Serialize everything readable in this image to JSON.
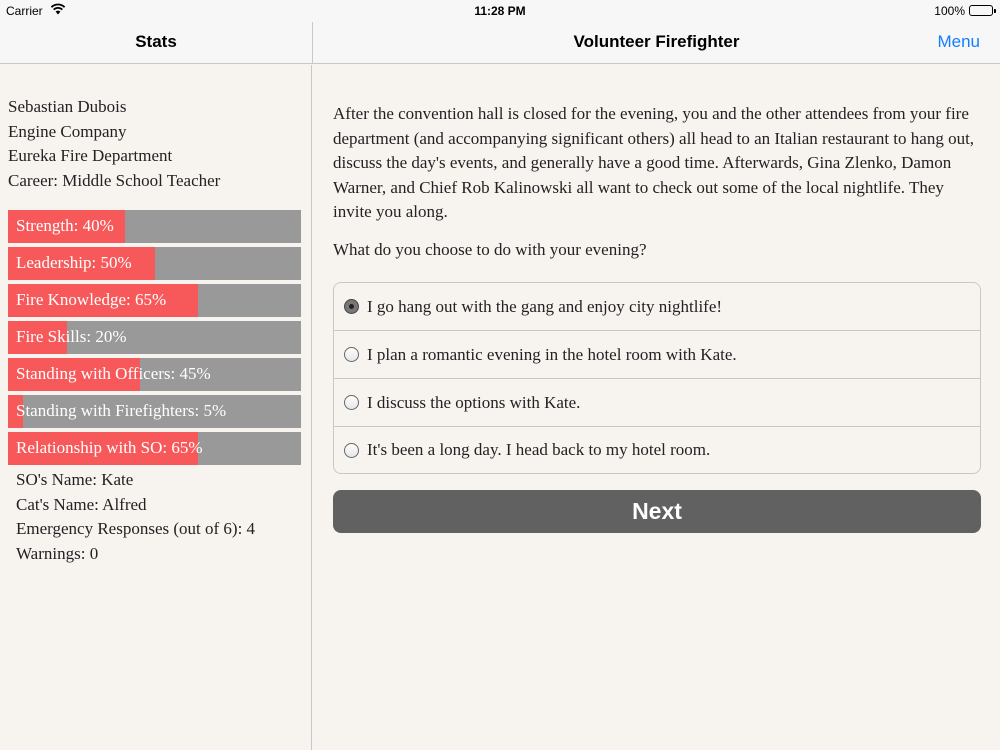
{
  "status_bar": {
    "carrier": "Carrier",
    "time": "11:28 PM",
    "battery": "100%"
  },
  "nav": {
    "left_title": "Stats",
    "title": "Volunteer Firefighter",
    "menu_label": "Menu"
  },
  "sidebar": {
    "info": [
      "Sebastian Dubois",
      "Engine Company",
      "Eureka Fire Department",
      "Career: Middle School Teacher"
    ],
    "stats": [
      {
        "label": "Strength: 40%",
        "value": 40
      },
      {
        "label": "Leadership: 50%",
        "value": 50
      },
      {
        "label": "Fire Knowledge: 65%",
        "value": 65
      },
      {
        "label": "Fire Skills: 20%",
        "value": 20
      },
      {
        "label": "Standing with Officers: 45%",
        "value": 45
      },
      {
        "label": "Standing with Firefighters: 5%",
        "value": 5
      },
      {
        "label": "Relationship with SO: 65%",
        "value": 65
      }
    ],
    "extra": [
      "SO's Name: Kate",
      "Cat's Name: Alfred",
      "Emergency Responses (out of 6): 4",
      "Warnings: 0"
    ]
  },
  "main": {
    "story": "After the convention hall is closed for the evening, you and the other attendees from your fire department (and accompanying significant others) all head to an Italian restaurant to hang out, discuss the day's events, and generally have a good time. Afterwards, Gina Zlenko, Damon Warner, and Chief Rob Kalinowski all want to check out some of the local nightlife. They invite you along.",
    "question": "What do you choose to do with your evening?",
    "choices": [
      "I go hang out with the gang and enjoy city nightlife!",
      "I plan a romantic evening in the hotel room with Kate.",
      "I discuss the options with Kate.",
      "It's been a long day. I head back to my hotel room."
    ],
    "selected_choice": 0,
    "next_label": "Next"
  },
  "colors": {
    "bar_fill": "#f7595a",
    "bar_track": "#999999",
    "menu_link": "#147efb",
    "next_button": "#616161"
  }
}
